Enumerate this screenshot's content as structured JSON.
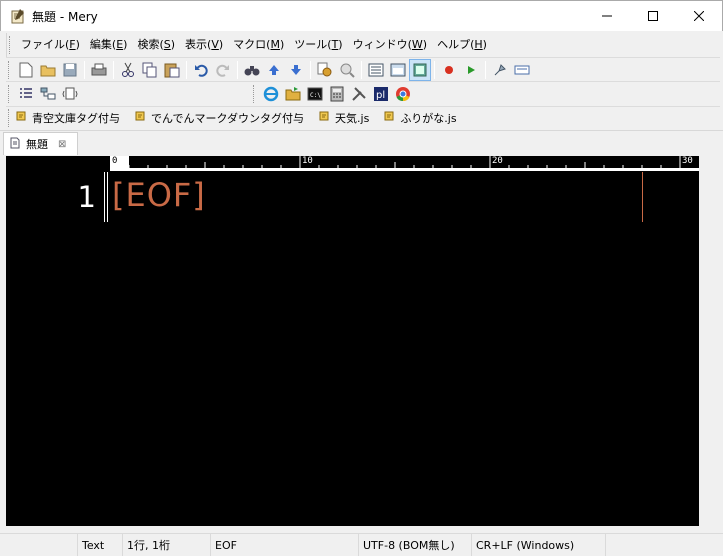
{
  "window": {
    "title": "無題 - Mery"
  },
  "menu": [
    {
      "label": "ファイル(",
      "key": "F",
      "end": ")"
    },
    {
      "label": "編集(",
      "key": "E",
      "end": ")"
    },
    {
      "label": "検索(",
      "key": "S",
      "end": ")"
    },
    {
      "label": "表示(",
      "key": "V",
      "end": ")"
    },
    {
      "label": "マクロ(",
      "key": "M",
      "end": ")"
    },
    {
      "label": "ツール(",
      "key": "T",
      "end": ")"
    },
    {
      "label": "ウィンドウ(",
      "key": "W",
      "end": ")"
    },
    {
      "label": "ヘルプ(",
      "key": "H",
      "end": ")"
    }
  ],
  "macros": [
    "青空文庫タグ付与",
    "でんでんマークダウンタグ付与",
    "天気.js",
    "ふりがな.js"
  ],
  "tab": {
    "label": "無題",
    "close": "⊠"
  },
  "ruler": {
    "labels": [
      "0",
      "10",
      "20",
      "30"
    ]
  },
  "editor": {
    "line_number": "1",
    "eof": "[EOF]"
  },
  "status": {
    "mode": "Text",
    "position": "1行, 1桁",
    "eof": "EOF",
    "encoding": "UTF-8 (BOM無し)",
    "newline": "CR+LF (Windows)"
  },
  "colors": {
    "eof": "#c96a46",
    "editor_bg": "#000000"
  }
}
